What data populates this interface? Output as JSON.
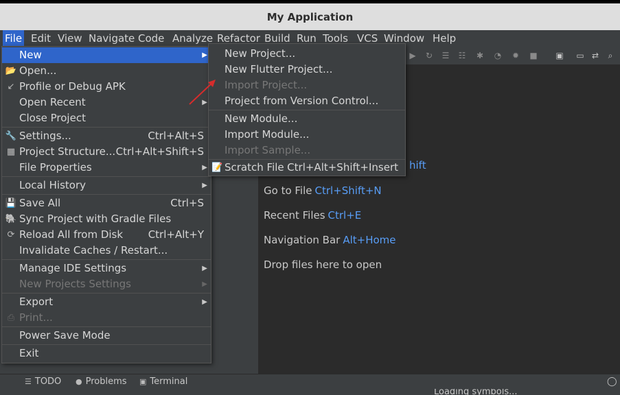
{
  "window": {
    "title": "My Application"
  },
  "menubar": {
    "items": [
      {
        "id": "file",
        "label": "File"
      },
      {
        "id": "edit",
        "label": "Edit"
      },
      {
        "id": "view",
        "label": "View"
      },
      {
        "id": "navigate",
        "label": "Navigate"
      },
      {
        "id": "code",
        "label": "Code"
      },
      {
        "id": "analyze",
        "label": "Analyze"
      },
      {
        "id": "refactor",
        "label": "Refactor"
      },
      {
        "id": "build",
        "label": "Build"
      },
      {
        "id": "run",
        "label": "Run"
      },
      {
        "id": "tools",
        "label": "Tools"
      },
      {
        "id": "vcs",
        "label": "VCS"
      },
      {
        "id": "window",
        "label": "Window"
      },
      {
        "id": "help",
        "label": "Help"
      }
    ]
  },
  "file_menu": {
    "new": "New",
    "open": "Open...",
    "profile_apk": "Profile or Debug APK",
    "open_recent": "Open Recent",
    "close_project": "Close Project",
    "settings": "Settings...",
    "settings_shortcut": "Ctrl+Alt+S",
    "project_structure": "Project Structure...",
    "project_structure_shortcut": "Ctrl+Alt+Shift+S",
    "file_properties": "File Properties",
    "local_history": "Local History",
    "save_all": "Save All",
    "save_all_shortcut": "Ctrl+S",
    "sync_gradle": "Sync Project with Gradle Files",
    "reload_all": "Reload All from Disk",
    "reload_all_shortcut": "Ctrl+Alt+Y",
    "invalidate_caches": "Invalidate Caches / Restart...",
    "manage_ide_settings": "Manage IDE Settings",
    "new_projects_settings": "New Projects Settings",
    "export": "Export",
    "print": "Print...",
    "power_save": "Power Save Mode",
    "exit": "Exit"
  },
  "new_submenu": {
    "new_project": "New Project...",
    "new_flutter_project": "New Flutter Project...",
    "import_project": "Import Project...",
    "project_from_vcs": "Project from Version Control...",
    "new_module": "New Module...",
    "import_module": "Import Module...",
    "import_sample": "Import Sample...",
    "scratch_file": "Scratch File",
    "scratch_file_shortcut": "Ctrl+Alt+Shift+Insert"
  },
  "editor_hints": {
    "partial_shortcut": "hift",
    "goto_file": "Go to File",
    "goto_file_shortcut": "Ctrl+Shift+N",
    "recent_files": "Recent Files",
    "recent_files_shortcut": "Ctrl+E",
    "nav_bar": "Navigation Bar",
    "nav_bar_shortcut": "Alt+Home",
    "drop_files": "Drop files here to open"
  },
  "bottom_tabs": {
    "todo": "TODO",
    "problems": "Problems",
    "terminal": "Terminal"
  },
  "status": {
    "loading": "Loading symbols..."
  },
  "colors": {
    "accent": "#2f65ca",
    "shortcut": "#589df6",
    "arrow": "#d62c2c"
  }
}
